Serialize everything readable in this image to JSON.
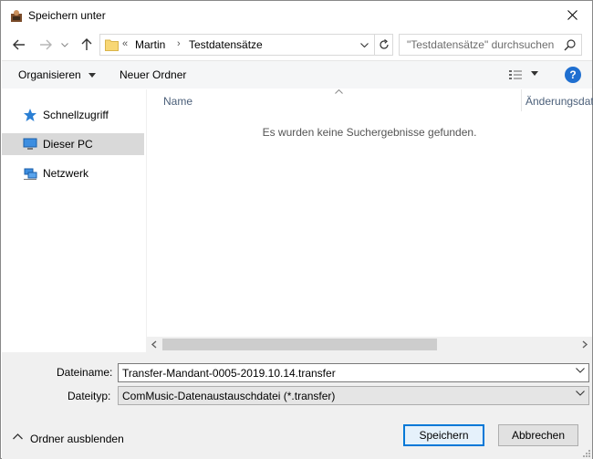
{
  "window": {
    "title": "Speichern unter",
    "close_label": "✕"
  },
  "nav": {
    "back": "back-arrow",
    "forward": "forward-arrow",
    "recent": "recent-dropdown",
    "up": "up-arrow"
  },
  "address": {
    "overflow": "«",
    "crumbs": [
      "Martin",
      "Testdatensätze"
    ],
    "separator": "›"
  },
  "search": {
    "placeholder": "\"Testdatensätze\" durchsuchen"
  },
  "commandbar": {
    "organize": "Organisieren",
    "new_folder": "Neuer Ordner",
    "help": "?"
  },
  "navpane": {
    "items": [
      {
        "label": "Schnellzugriff",
        "icon": "star-icon"
      },
      {
        "label": "Dieser PC",
        "icon": "computer-icon",
        "selected": true
      },
      {
        "label": "Netzwerk",
        "icon": "network-icon"
      }
    ]
  },
  "filelist": {
    "columns": [
      "Name",
      "Änderungsdatum"
    ],
    "empty_message": "Es wurden keine Suchergebnisse gefunden."
  },
  "form": {
    "filename_label": "Dateiname:",
    "filename_value": "Transfer-Mandant-0005-2019.10.14.transfer",
    "filetype_label": "Dateityp:",
    "filetype_value": "ComMusic-Datenaustauschdatei (*.transfer)"
  },
  "footer": {
    "hide_folders": "Ordner ausblenden",
    "save": "Speichern",
    "cancel": "Abbrechen"
  },
  "colors": {
    "accent": "#0078d7",
    "help": "#1f6fd0",
    "folder": "#f8d775",
    "selected": "#d9d9d9"
  }
}
